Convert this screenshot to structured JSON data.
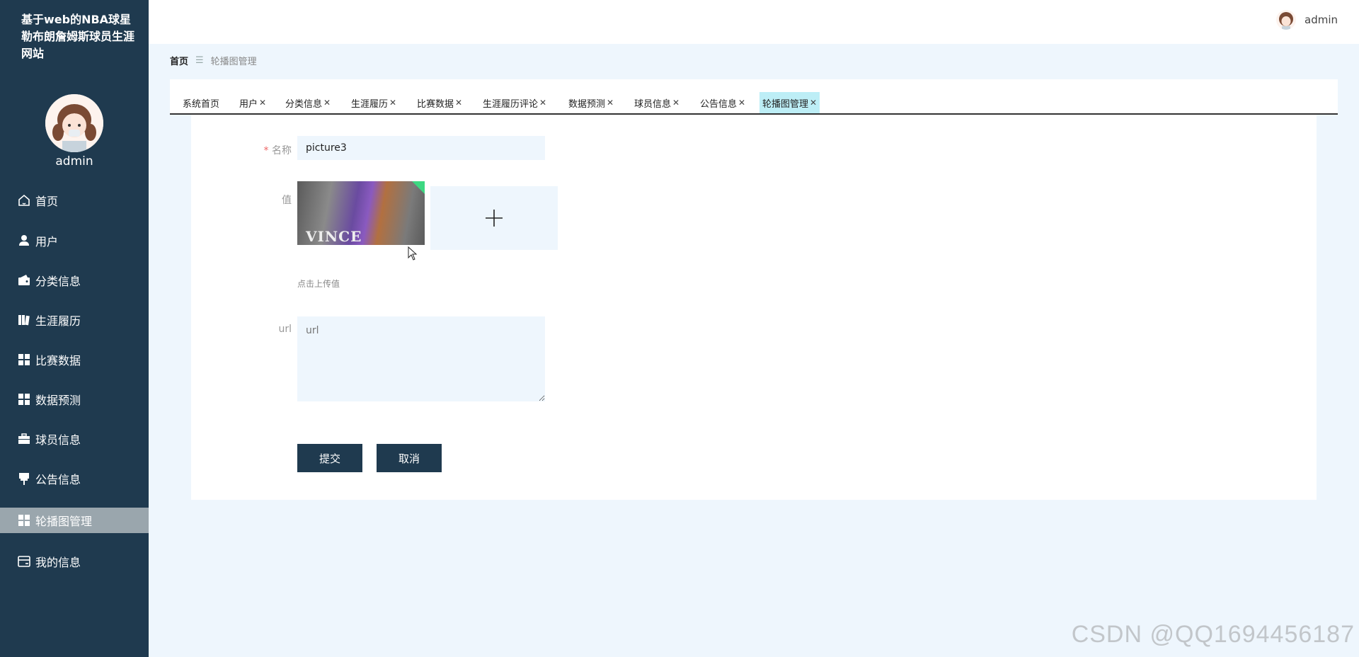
{
  "sidebar": {
    "site_title": "基于web的NBA球星勒布朗詹姆斯球员生涯网站",
    "username": "admin",
    "items": [
      {
        "label": "首页",
        "icon": "home-icon"
      },
      {
        "label": "用户",
        "icon": "user-icon"
      },
      {
        "label": "分类信息",
        "icon": "wallet-icon"
      },
      {
        "label": "生涯履历",
        "icon": "book-icon"
      },
      {
        "label": "比赛数据",
        "icon": "grid-icon"
      },
      {
        "label": "数据预测",
        "icon": "grid-icon"
      },
      {
        "label": "球员信息",
        "icon": "briefcase-icon"
      },
      {
        "label": "公告信息",
        "icon": "pin-icon"
      },
      {
        "label": "轮播图管理",
        "icon": "grid-icon",
        "active": true
      },
      {
        "label": "我的信息",
        "icon": "card-icon"
      }
    ]
  },
  "header": {
    "username": "admin"
  },
  "breadcrumb": {
    "home": "首页",
    "current": "轮播图管理"
  },
  "tabs": [
    {
      "label": "系统首页",
      "closable": false
    },
    {
      "label": "用户",
      "closable": true
    },
    {
      "label": "分类信息",
      "closable": true
    },
    {
      "label": "生涯履历",
      "closable": true
    },
    {
      "label": "比赛数据",
      "closable": true
    },
    {
      "label": "生涯履历评论",
      "closable": true
    },
    {
      "label": "数据预测",
      "closable": true
    },
    {
      "label": "球员信息",
      "closable": true
    },
    {
      "label": "公告信息",
      "closable": true
    },
    {
      "label": "轮播图管理",
      "closable": true,
      "active": true
    }
  ],
  "form": {
    "name_required": "*",
    "name_label": "名称",
    "name_value": "picture3",
    "value_label": "值",
    "thumb_text": "VINCE",
    "upload_hint": "点击上传值",
    "url_label": "url",
    "url_placeholder": "url",
    "submit_label": "提交",
    "cancel_label": "取消"
  },
  "watermark": "CSDN @QQ1694456187",
  "colors": {
    "sidebar_bg": "#1f3a4f",
    "page_bg": "#eef6fd",
    "active_tab": "#bdeef6",
    "active_menu": "#9aa6ad",
    "button_bg": "#1f3a4f"
  }
}
